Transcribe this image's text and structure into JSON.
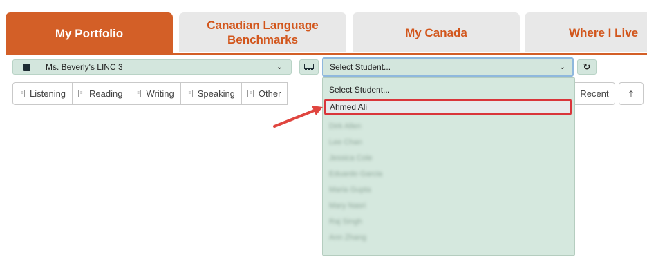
{
  "tabs": [
    {
      "label": "My Portfolio",
      "active": true
    },
    {
      "label": "Canadian Language Benchmarks",
      "active": false
    },
    {
      "label": "My Canada",
      "active": false
    },
    {
      "label": "Where I Live",
      "active": false
    }
  ],
  "class_select": {
    "value": "Ms. Beverly's LINC 3",
    "icon": "book-icon"
  },
  "student_select": {
    "value": "Select Student..."
  },
  "skill_filters": [
    "Listening",
    "Reading",
    "Writing",
    "Speaking",
    "Other"
  ],
  "recent_label": "Recent",
  "upload_icon": "upload-icon",
  "dropdown": {
    "options": [
      "Select Student...",
      "Ahmed Ali",
      "Dirk Allen",
      "Lee Chan",
      "Jessica Cole",
      "Eduardo Garcia",
      "Maria Gupta",
      "Mary Nasri",
      "Raj Singh",
      "Ann Zhang"
    ],
    "highlighted_index": 1
  },
  "colors": {
    "accent": "#d35f27",
    "control_bg": "#d3e6dd",
    "highlight_border": "#d9353a"
  }
}
